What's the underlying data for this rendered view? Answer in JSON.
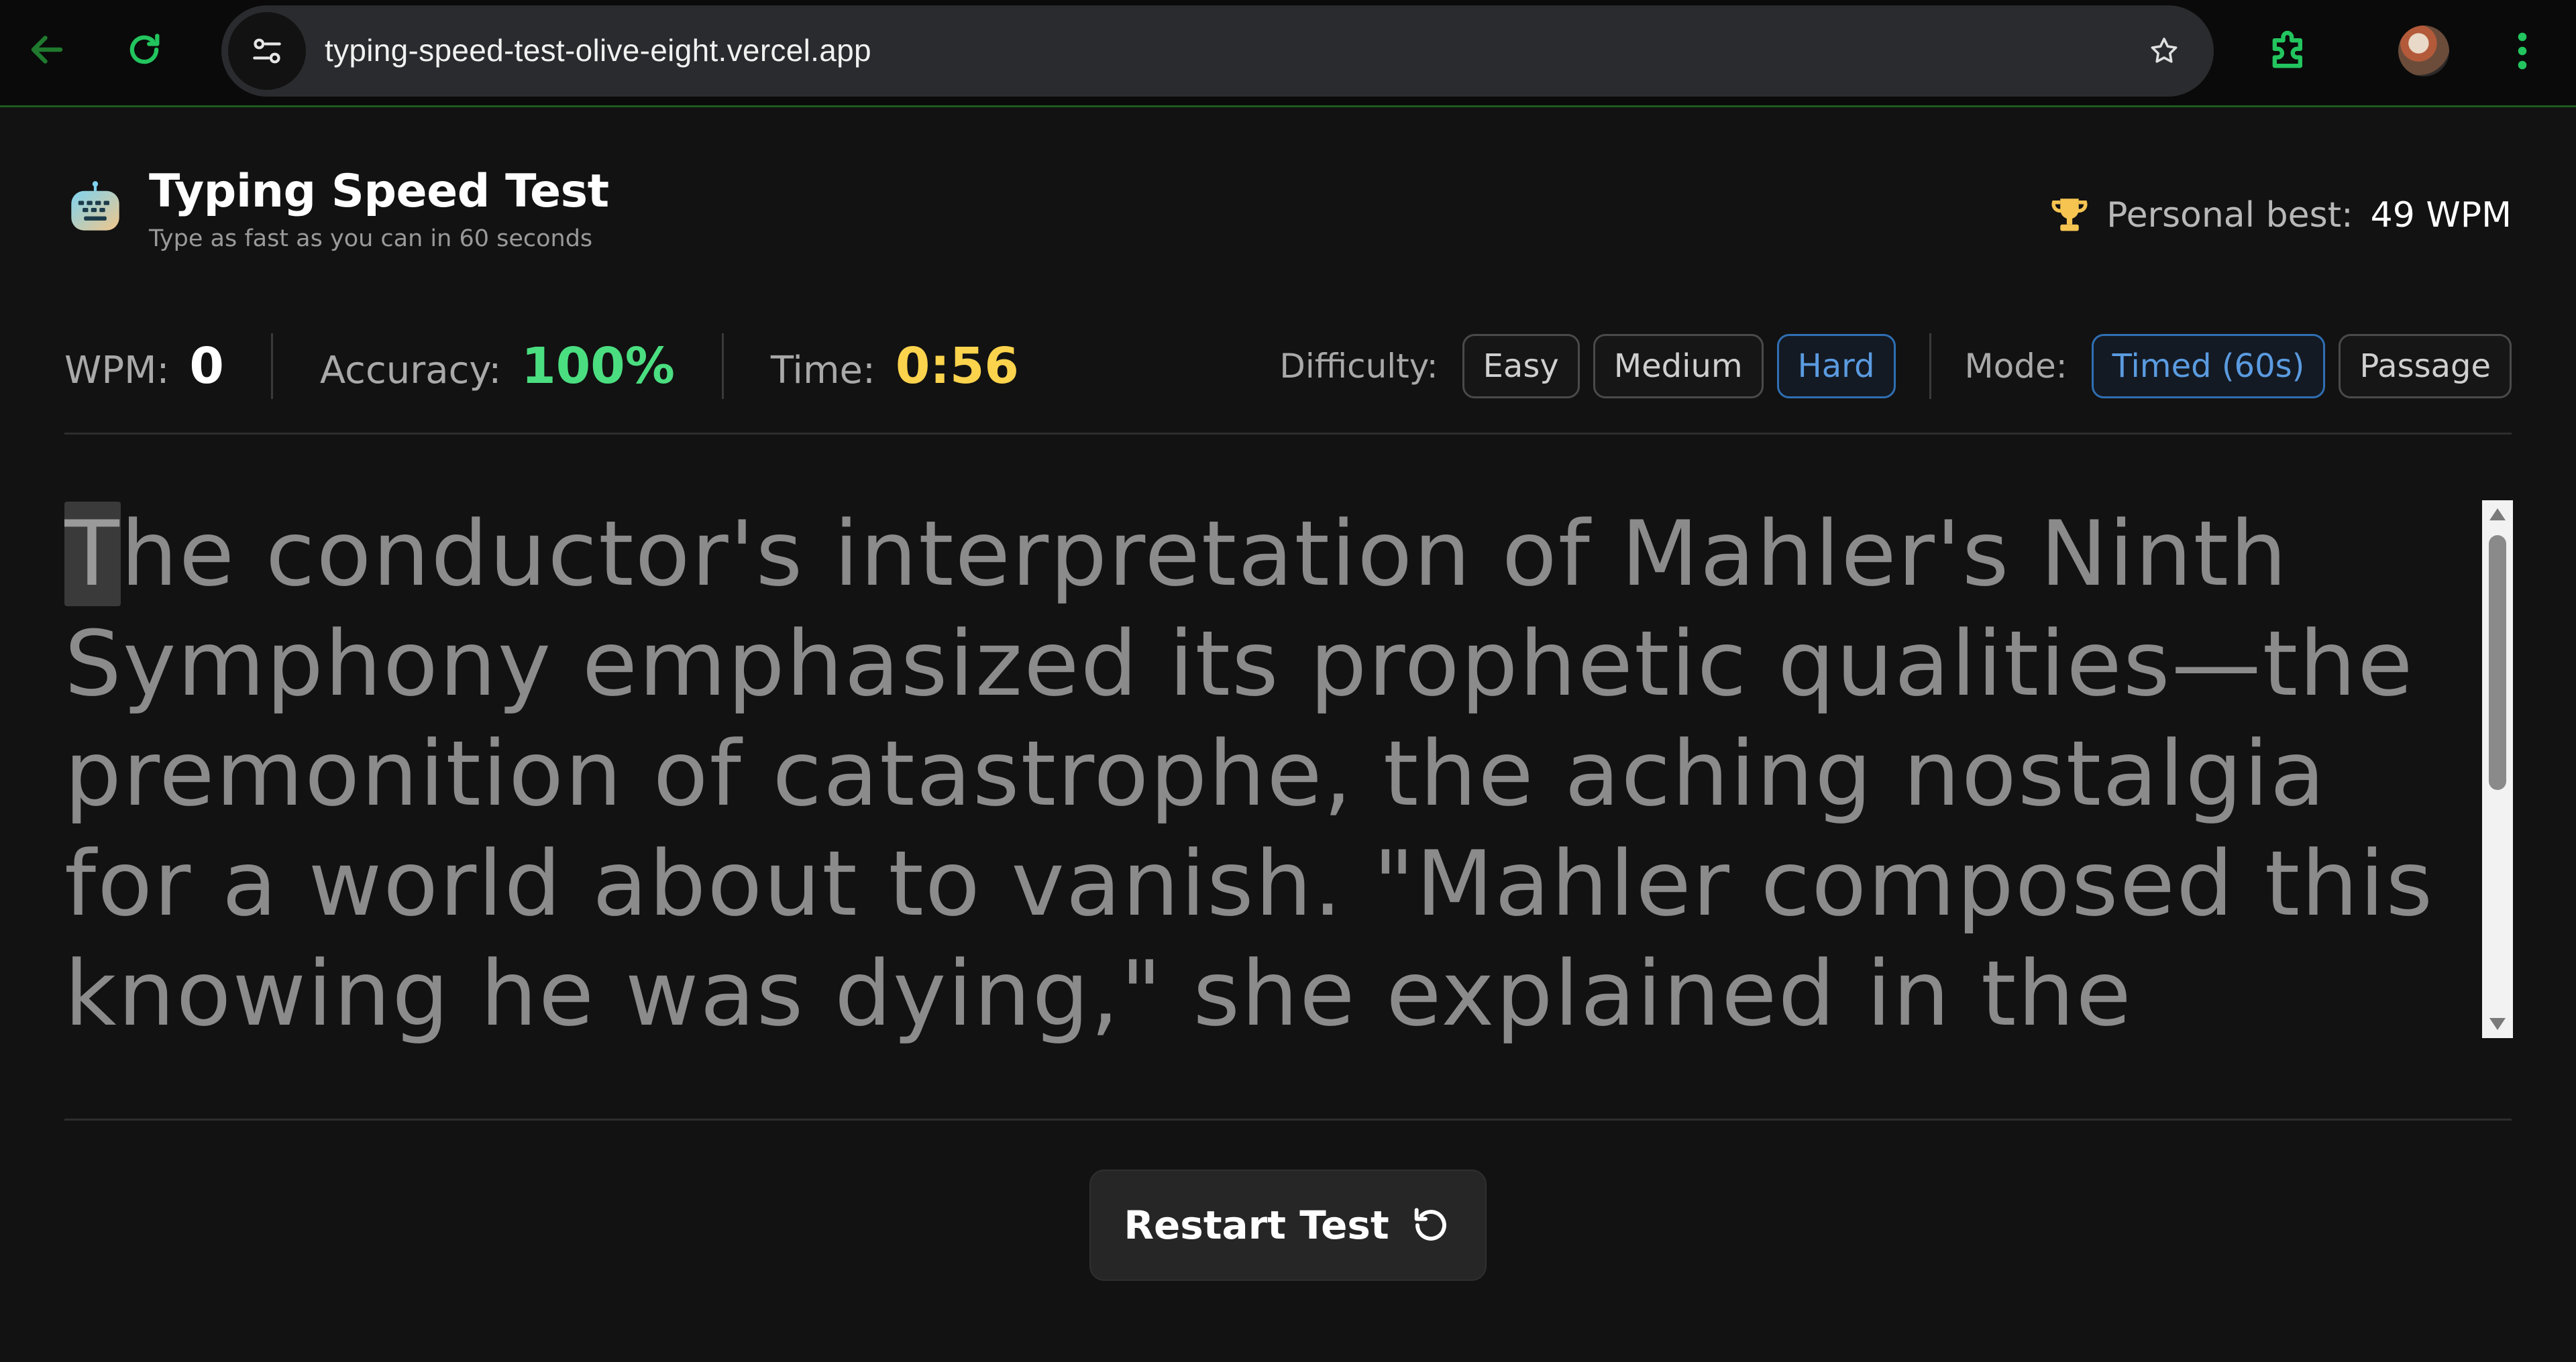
{
  "browser": {
    "url": "typing-speed-test-olive-eight.vercel.app",
    "icons": [
      "back-arrow-icon",
      "reload-icon",
      "site-settings-icon",
      "bookmark-star-icon",
      "extensions-puzzle-icon",
      "profile-avatar",
      "menu-kebab-icon"
    ],
    "accent": "#22c55e"
  },
  "header": {
    "title": "Typing Speed Test",
    "subtitle": "Type as fast as you can in 60 seconds",
    "personal_best_label": "Personal best:",
    "personal_best_value": "49 WPM"
  },
  "stats": {
    "wpm_label": "WPM:",
    "wpm_value": "0",
    "accuracy_label": "Accuracy:",
    "accuracy_value": "100%",
    "time_label": "Time:",
    "time_value": "0:56"
  },
  "difficulty": {
    "label": "Difficulty:",
    "options": [
      "Easy",
      "Medium",
      "Hard"
    ],
    "selected": "Hard"
  },
  "mode": {
    "label": "Mode:",
    "options": [
      "Timed (60s)",
      "Passage"
    ],
    "selected": "Timed (60s)"
  },
  "passage": {
    "cursor_char": "T",
    "rest": "he conductor's interpretation of Mahler's Ninth Symphony emphasized its prophetic qualities—the premonition of catastrophe, the aching nostalgia for a world about to vanish. \"Mahler composed this knowing he was dying,\" she explained in the program notes, \"but he"
  },
  "restart": {
    "label": "Restart Test"
  },
  "colors": {
    "background": "#121212",
    "accuracy": "#4ade80",
    "time": "#fcd34d",
    "active_pill": "#5b9be0",
    "trophy": "#f5c451"
  }
}
